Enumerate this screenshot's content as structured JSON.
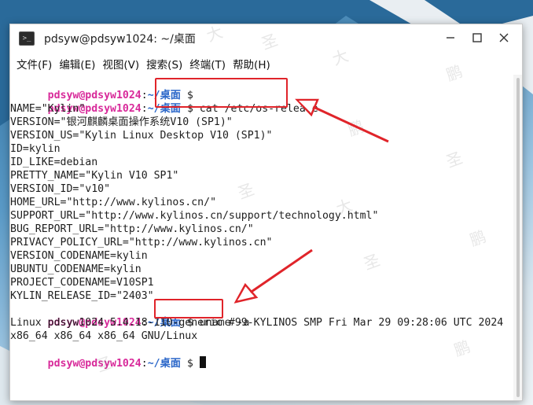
{
  "window": {
    "title": "pdsyw@pdsyw1024: ~/桌面",
    "app_icon_glyph": ">_"
  },
  "menu": [
    {
      "label": "文件(F)"
    },
    {
      "label": "编辑(E)"
    },
    {
      "label": "视图(V)"
    },
    {
      "label": "搜索(S)"
    },
    {
      "label": "终端(T)"
    },
    {
      "label": "帮助(H)"
    }
  ],
  "prompt": {
    "user": "pdsyw@pdsyw1024",
    "colon": ":",
    "path": "~/桌面",
    "dollar": "$"
  },
  "commands": {
    "cmd1": "cat /etc/os-release",
    "cmd2": "uname -a"
  },
  "output": {
    "os_release": [
      "NAME=\"Kylin\"",
      "VERSION=\"银河麒麟桌面操作系统V10 (SP1)\"",
      "VERSION_US=\"Kylin Linux Desktop V10 (SP1)\"",
      "ID=kylin",
      "ID_LIKE=debian",
      "PRETTY_NAME=\"Kylin V10 SP1\"",
      "VERSION_ID=\"v10\"",
      "HOME_URL=\"http://www.kylinos.cn/\"",
      "SUPPORT_URL=\"http://www.kylinos.cn/support/technology.html\"",
      "BUG_REPORT_URL=\"http://www.kylinos.cn/\"",
      "PRIVACY_POLICY_URL=\"http://www.kylinos.cn\"",
      "VERSION_CODENAME=kylin",
      "UBUNTU_CODENAME=kylin",
      "PROJECT_CODENAME=V10SP1",
      "KYLIN_RELEASE_ID=\"2403\""
    ],
    "uname": [
      "Linux pdsyw1024 5.4.18-110-generic #99-KYLINOS SMP Fri Mar 29 09:28:06 UTC 2024",
      "x86_64 x86_64 x86_64 GNU/Linux"
    ]
  },
  "watermark_chars": [
    "大",
    "圣",
    "鹏"
  ],
  "colors": {
    "prompt_user": "#d82a9a",
    "prompt_path": "#2b67c9",
    "annotation_red": "#e0242a"
  }
}
